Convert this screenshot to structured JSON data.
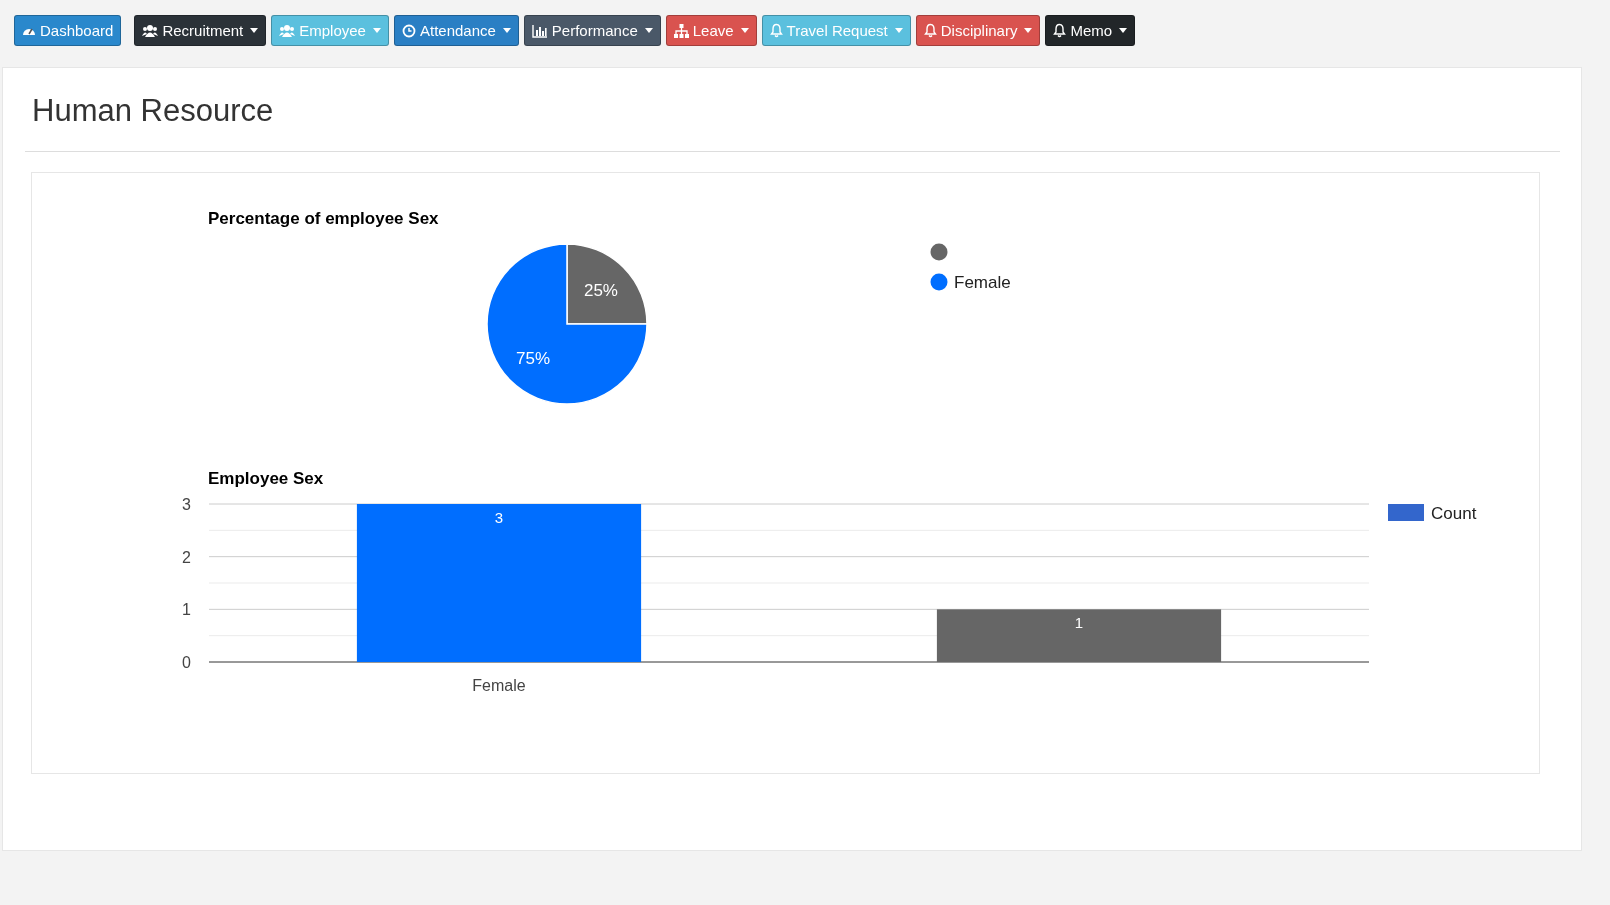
{
  "nav": [
    {
      "label": "Dashboard",
      "kind": "gauge",
      "color": "#2a88cc",
      "dropdown": false
    },
    {
      "label": "Recruitment",
      "kind": "users",
      "color": "#2b3238",
      "dropdown": true
    },
    {
      "label": "Employee",
      "kind": "users",
      "color": "#5bc0de",
      "dropdown": true
    },
    {
      "label": "Attendance",
      "kind": "clock",
      "color": "#2a7fc4",
      "dropdown": true
    },
    {
      "label": "Performance",
      "kind": "chart",
      "color": "#4a5868",
      "dropdown": true
    },
    {
      "label": "Leave",
      "kind": "sitemap",
      "color": "#d9534f",
      "dropdown": true
    },
    {
      "label": "Travel Request",
      "kind": "bell",
      "color": "#5bc0de",
      "dropdown": true
    },
    {
      "label": "Disciplinary",
      "kind": "bell",
      "color": "#d9534f",
      "dropdown": true
    },
    {
      "label": "Memo",
      "kind": "bell",
      "color": "#222629",
      "dropdown": true
    }
  ],
  "page": {
    "title": "Human Resource"
  },
  "pie": {
    "chart_data": {
      "type": "pie",
      "title": "Percentage of employee Sex",
      "categories": [
        null,
        "Female"
      ],
      "values": [
        25,
        75
      ],
      "colors": [
        "#666666",
        "#006eff"
      ],
      "value_labels": [
        "25%",
        "75%"
      ]
    }
  },
  "bar": {
    "chart_data": {
      "type": "bar",
      "title": "Employee Sex",
      "categories": [
        "Female",
        null
      ],
      "series": [
        {
          "name": "Count",
          "values": [
            3,
            1
          ]
        }
      ],
      "colors": [
        "#006eff",
        "#666666"
      ],
      "ylim": [
        0,
        3
      ],
      "yticks": [
        0,
        1,
        2,
        3
      ],
      "data_labels": true
    },
    "legend_swatch": {
      "color": "#3366cc"
    }
  }
}
